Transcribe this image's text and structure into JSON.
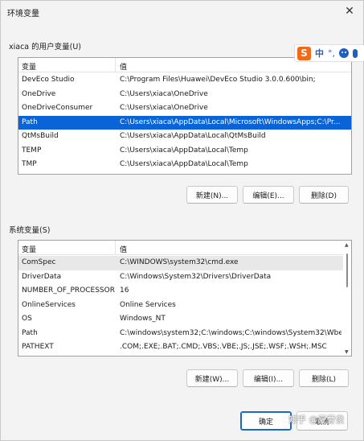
{
  "window": {
    "title": "环境变量"
  },
  "user_vars": {
    "label": "xiaca 的用户变量(U)",
    "columns": [
      "变量",
      "值"
    ],
    "rows": [
      {
        "name": "DevEco Studio",
        "value": "C:\\Program Files\\Huawei\\DevEco Studio 3.0.0.600\\bin;"
      },
      {
        "name": "OneDrive",
        "value": "C:\\Users\\xiaca\\OneDrive"
      },
      {
        "name": "OneDriveConsumer",
        "value": "C:\\Users\\xiaca\\OneDrive"
      },
      {
        "name": "Path",
        "value": "C:\\Users\\xiaca\\AppData\\Local\\Microsoft\\WindowsApps;C:\\Pr..."
      },
      {
        "name": "QtMsBuild",
        "value": "C:\\Users\\xiaca\\AppData\\Local\\QtMsBuild"
      },
      {
        "name": "TEMP",
        "value": "C:\\Users\\xiaca\\AppData\\Local\\Temp"
      },
      {
        "name": "TMP",
        "value": "C:\\Users\\xiaca\\AppData\\Local\\Temp"
      }
    ],
    "buttons": {
      "new": "新建(N)...",
      "edit": "编辑(E)...",
      "delete": "删除(D)"
    }
  },
  "system_vars": {
    "label": "系统变量(S)",
    "columns": [
      "变量",
      "值"
    ],
    "rows": [
      {
        "name": "ComSpec",
        "value": "C:\\WINDOWS\\system32\\cmd.exe"
      },
      {
        "name": "DriverData",
        "value": "C:\\Windows\\System32\\Drivers\\DriverData"
      },
      {
        "name": "NUMBER_OF_PROCESSORS",
        "value": "16"
      },
      {
        "name": "OnlineServices",
        "value": "Online Services"
      },
      {
        "name": "OS",
        "value": "Windows_NT"
      },
      {
        "name": "Path",
        "value": "C:\\windows\\system32;C:\\windows;C:\\windows\\System32\\Wbe..."
      },
      {
        "name": "PATHEXT",
        "value": ".COM;.EXE;.BAT;.CMD;.VBS;.VBE;.JS;.JSE;.WSF;.WSH;.MSC"
      }
    ],
    "buttons": {
      "new": "新建(W)...",
      "edit": "编辑(I)...",
      "delete": "删除(L)"
    }
  },
  "footer": {
    "ok": "确定",
    "cancel": "取消"
  },
  "ime": {
    "logo": "S",
    "mode": "中"
  },
  "watermark": "知乎 @夏曹俊",
  "colors": {
    "selection": "#0a64d8",
    "ime_brand": "#f06a1a"
  }
}
